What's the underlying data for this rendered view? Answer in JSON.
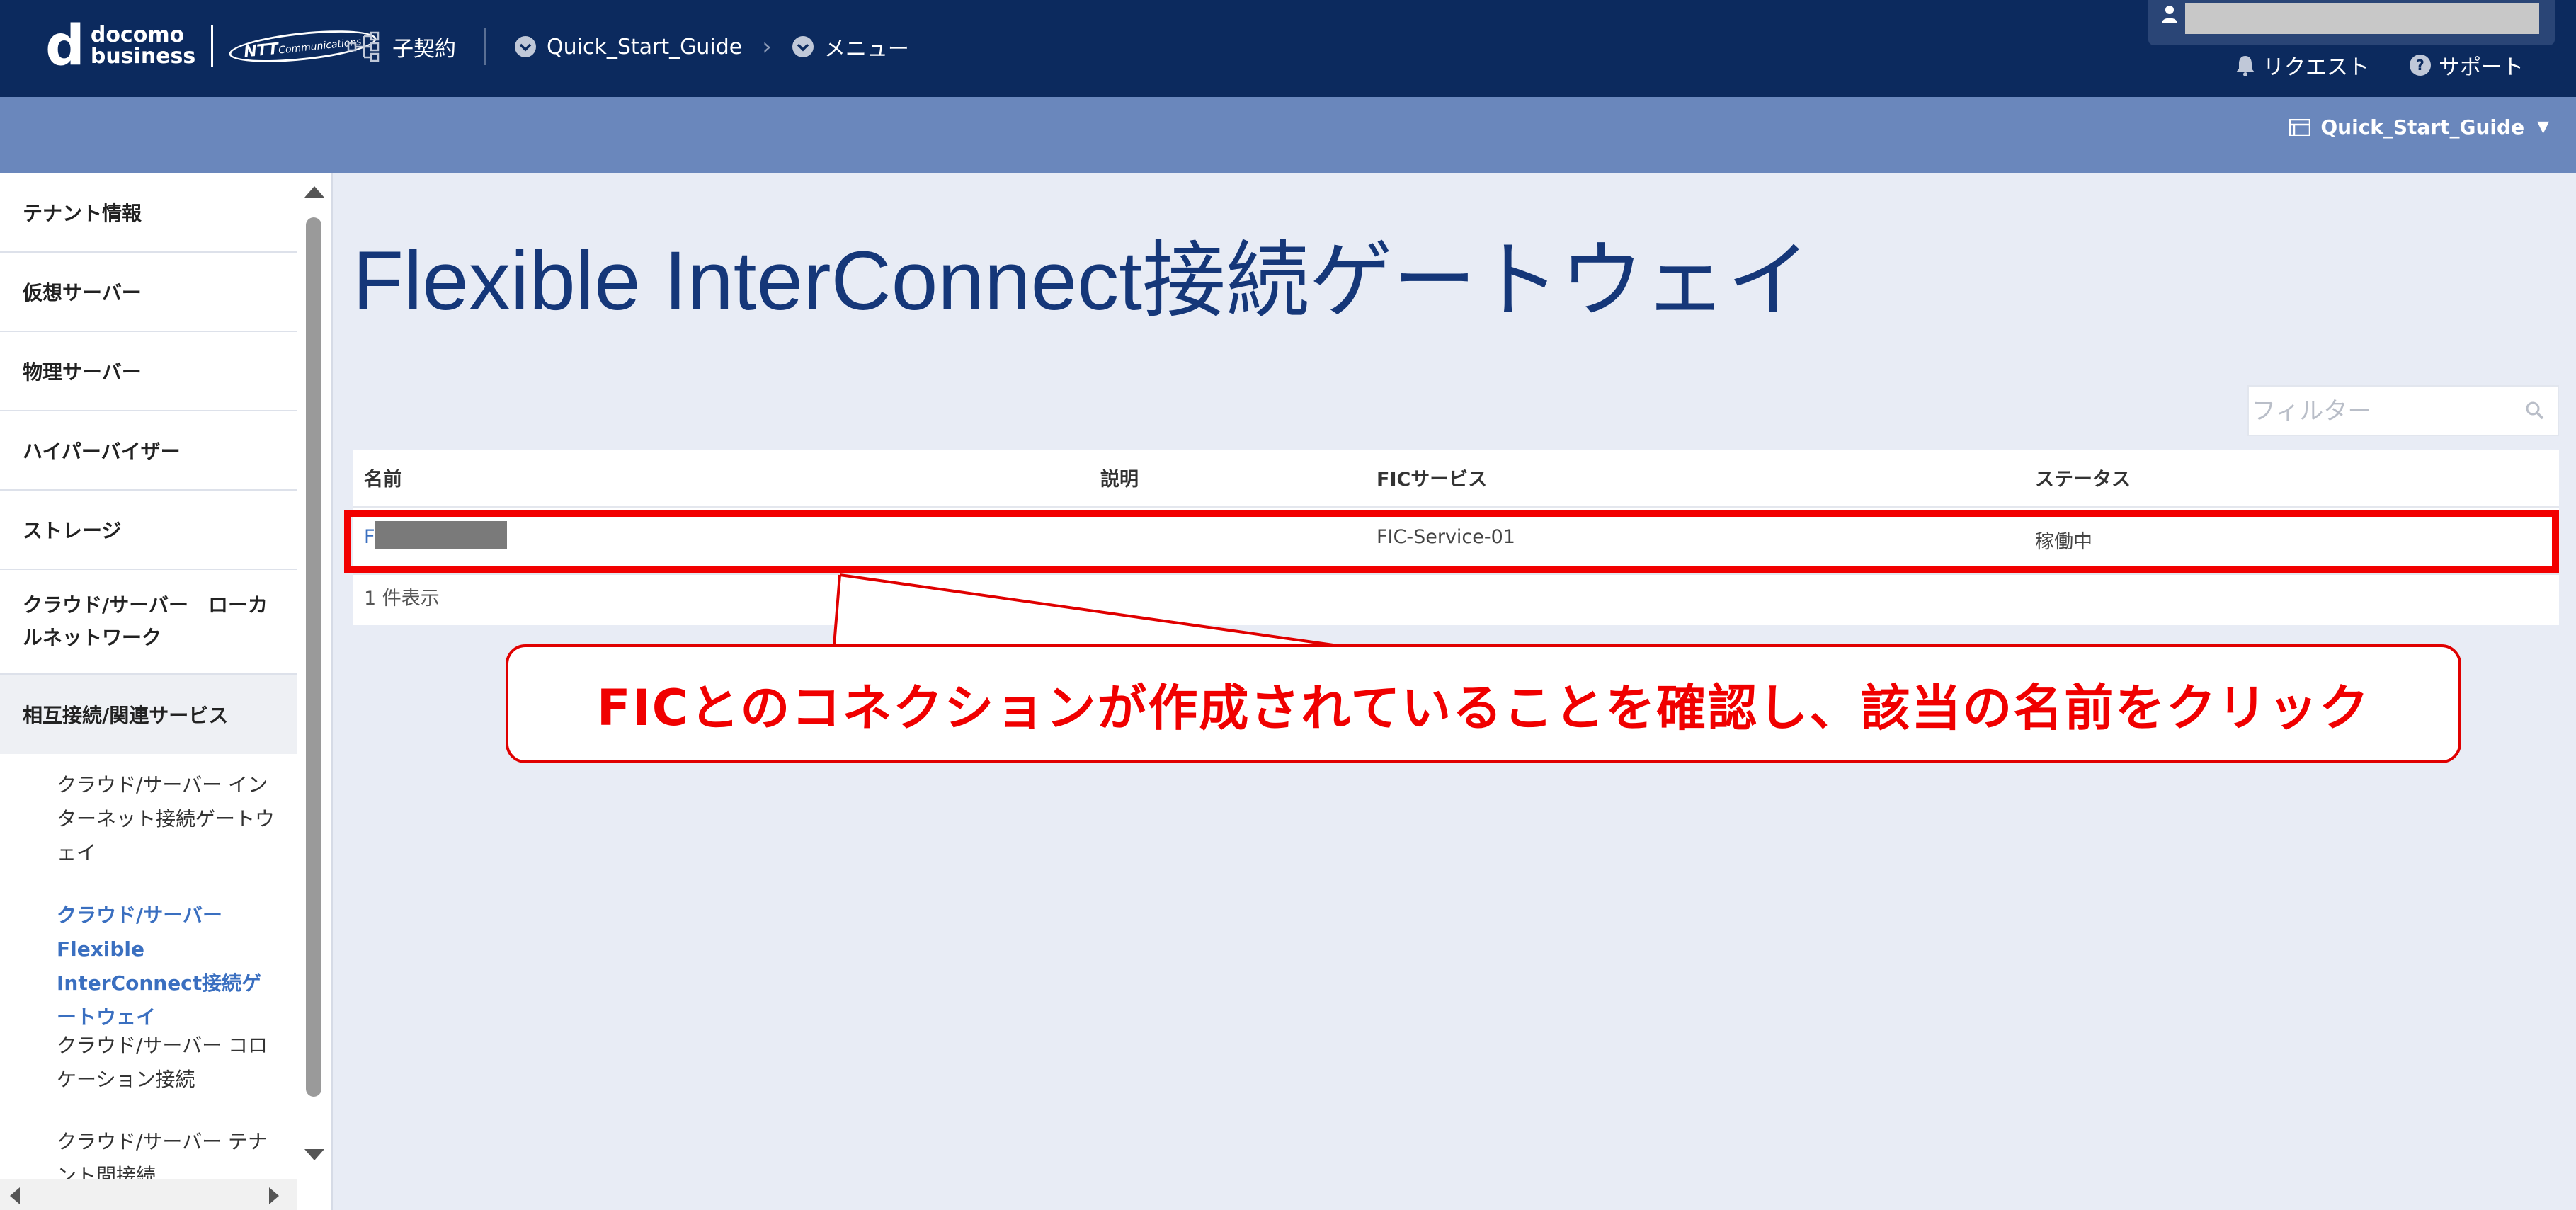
{
  "header": {
    "logo_mark": "d",
    "logo_line1": "docomo",
    "logo_line2": "business",
    "logo_ntt": "NTT",
    "logo_ntt_sub": "Communications",
    "crumb_contract": "子契約",
    "crumb_tenant": "Quick_Start_Guide",
    "crumb_menu": "メニュー",
    "request_label": "リクエスト",
    "support_label": "サポート"
  },
  "subbar": {
    "tenant_label": "Quick_Start_Guide"
  },
  "sidebar": {
    "items": [
      {
        "label": "テナント情報"
      },
      {
        "label": "仮想サーバー"
      },
      {
        "label": "物理サーバー"
      },
      {
        "label": "ハイパーバイザー"
      },
      {
        "label": "ストレージ"
      },
      {
        "label": "クラウド/サーバー　ローカルネットワーク"
      },
      {
        "label": "相互接続/関連サービス"
      }
    ],
    "subitems": [
      {
        "label": "クラウド/サーバー インターネット接続ゲートウェイ"
      },
      {
        "label": "クラウド/サーバー Flexible InterConnect接続ゲートウェイ"
      },
      {
        "label": "クラウド/サーバー コロケーション接続"
      },
      {
        "label": "クラウド/サーバー テナント間接続"
      }
    ]
  },
  "main": {
    "title": "Flexible InterConnect接続ゲートウェイ",
    "filter_placeholder": "フィルター",
    "columns": [
      "名前",
      "説明",
      "FICサービス",
      "ステータス"
    ],
    "rows": [
      {
        "name": "F",
        "description": "",
        "fic_service": "FIC-Service-01",
        "status": "稼働中"
      }
    ],
    "count_text": "1 件表示"
  },
  "annotation": {
    "text": "FICとのコネクションが作成されていることを確認し、該当の名前をクリック",
    "color": "#f00000"
  },
  "colors": {
    "topbar": "#0c2a5e",
    "subbar": "#6a87bc",
    "title": "#153779",
    "link": "#3a6fc0"
  }
}
